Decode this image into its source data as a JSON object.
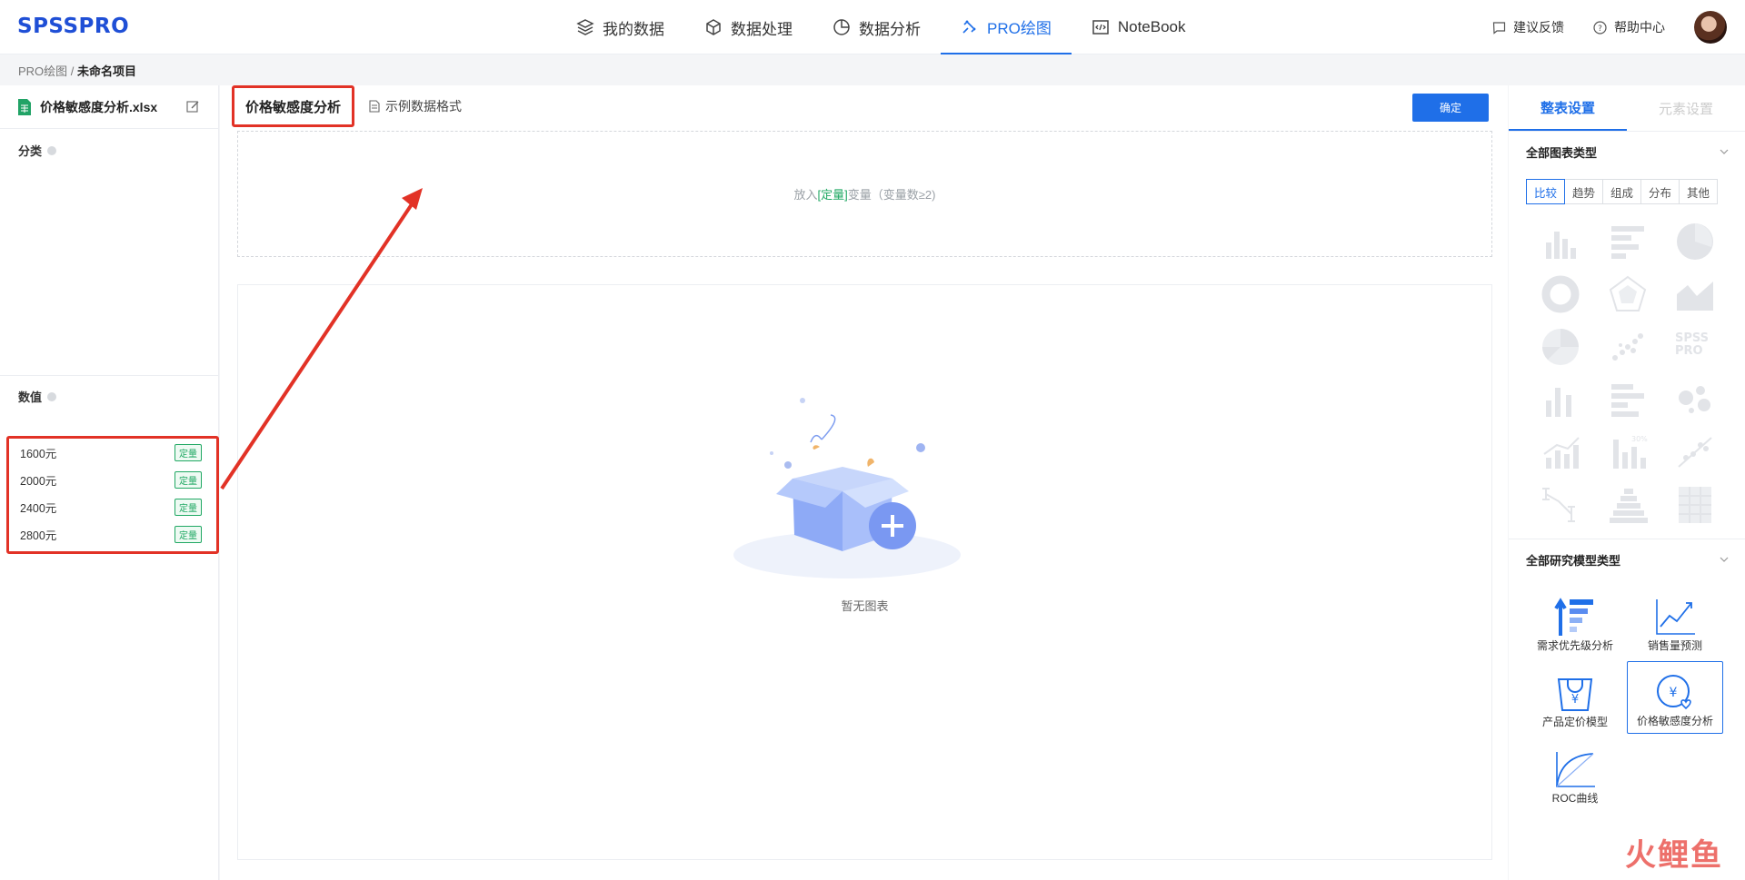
{
  "app": {
    "logo": "SPSSPRO",
    "colors": {
      "accent": "#1f6fe8",
      "quant": "#20a863",
      "annotation": "#e23226"
    }
  },
  "nav": {
    "items": [
      {
        "label": "我的数据",
        "icon": "layers-icon"
      },
      {
        "label": "数据处理",
        "icon": "cube-icon"
      },
      {
        "label": "数据分析",
        "icon": "pie-icon"
      },
      {
        "label": "PRO绘图",
        "icon": "brush-icon",
        "active": true
      },
      {
        "label": "NoteBook",
        "icon": "code-icon"
      }
    ]
  },
  "topright": {
    "feedback": "建议反馈",
    "help": "帮助中心"
  },
  "breadcrumb": {
    "root": "PRO绘图",
    "sep": "/",
    "current": "未命名项目"
  },
  "left": {
    "file_name": "价格敏感度分析.xlsx",
    "category_title": "分类",
    "value_title": "数值",
    "variables": [
      {
        "name": "1600元",
        "tag": "定量"
      },
      {
        "name": "2000元",
        "tag": "定量"
      },
      {
        "name": "2400元",
        "tag": "定量"
      },
      {
        "name": "2800元",
        "tag": "定量"
      }
    ]
  },
  "main": {
    "tab_active": "价格敏感度分析",
    "tab_sample": "示例数据格式",
    "confirm": "确定",
    "drop_pre": "放入",
    "drop_q": "[定量]",
    "drop_post": "变量（变量数≥2)",
    "empty": "暂无图表"
  },
  "right": {
    "tab_active": "整表设置",
    "tab_inactive": "元素设置",
    "all_chart_types": "全部图表类型",
    "filters": [
      "比较",
      "趋势",
      "组成",
      "分布",
      "其他"
    ],
    "all_models": "全部研究模型类型",
    "models": [
      {
        "label": "需求优先级分析",
        "icon": "priority-icon"
      },
      {
        "label": "销售量预测",
        "icon": "trend-chart-icon"
      },
      {
        "label": "产品定价模型",
        "icon": "price-bag-icon"
      },
      {
        "label": "价格敏感度分析",
        "icon": "price-heart-icon",
        "selected": true
      },
      {
        "label": "ROC曲线",
        "icon": "roc-curve-icon"
      }
    ]
  },
  "watermark": "火鲤鱼"
}
